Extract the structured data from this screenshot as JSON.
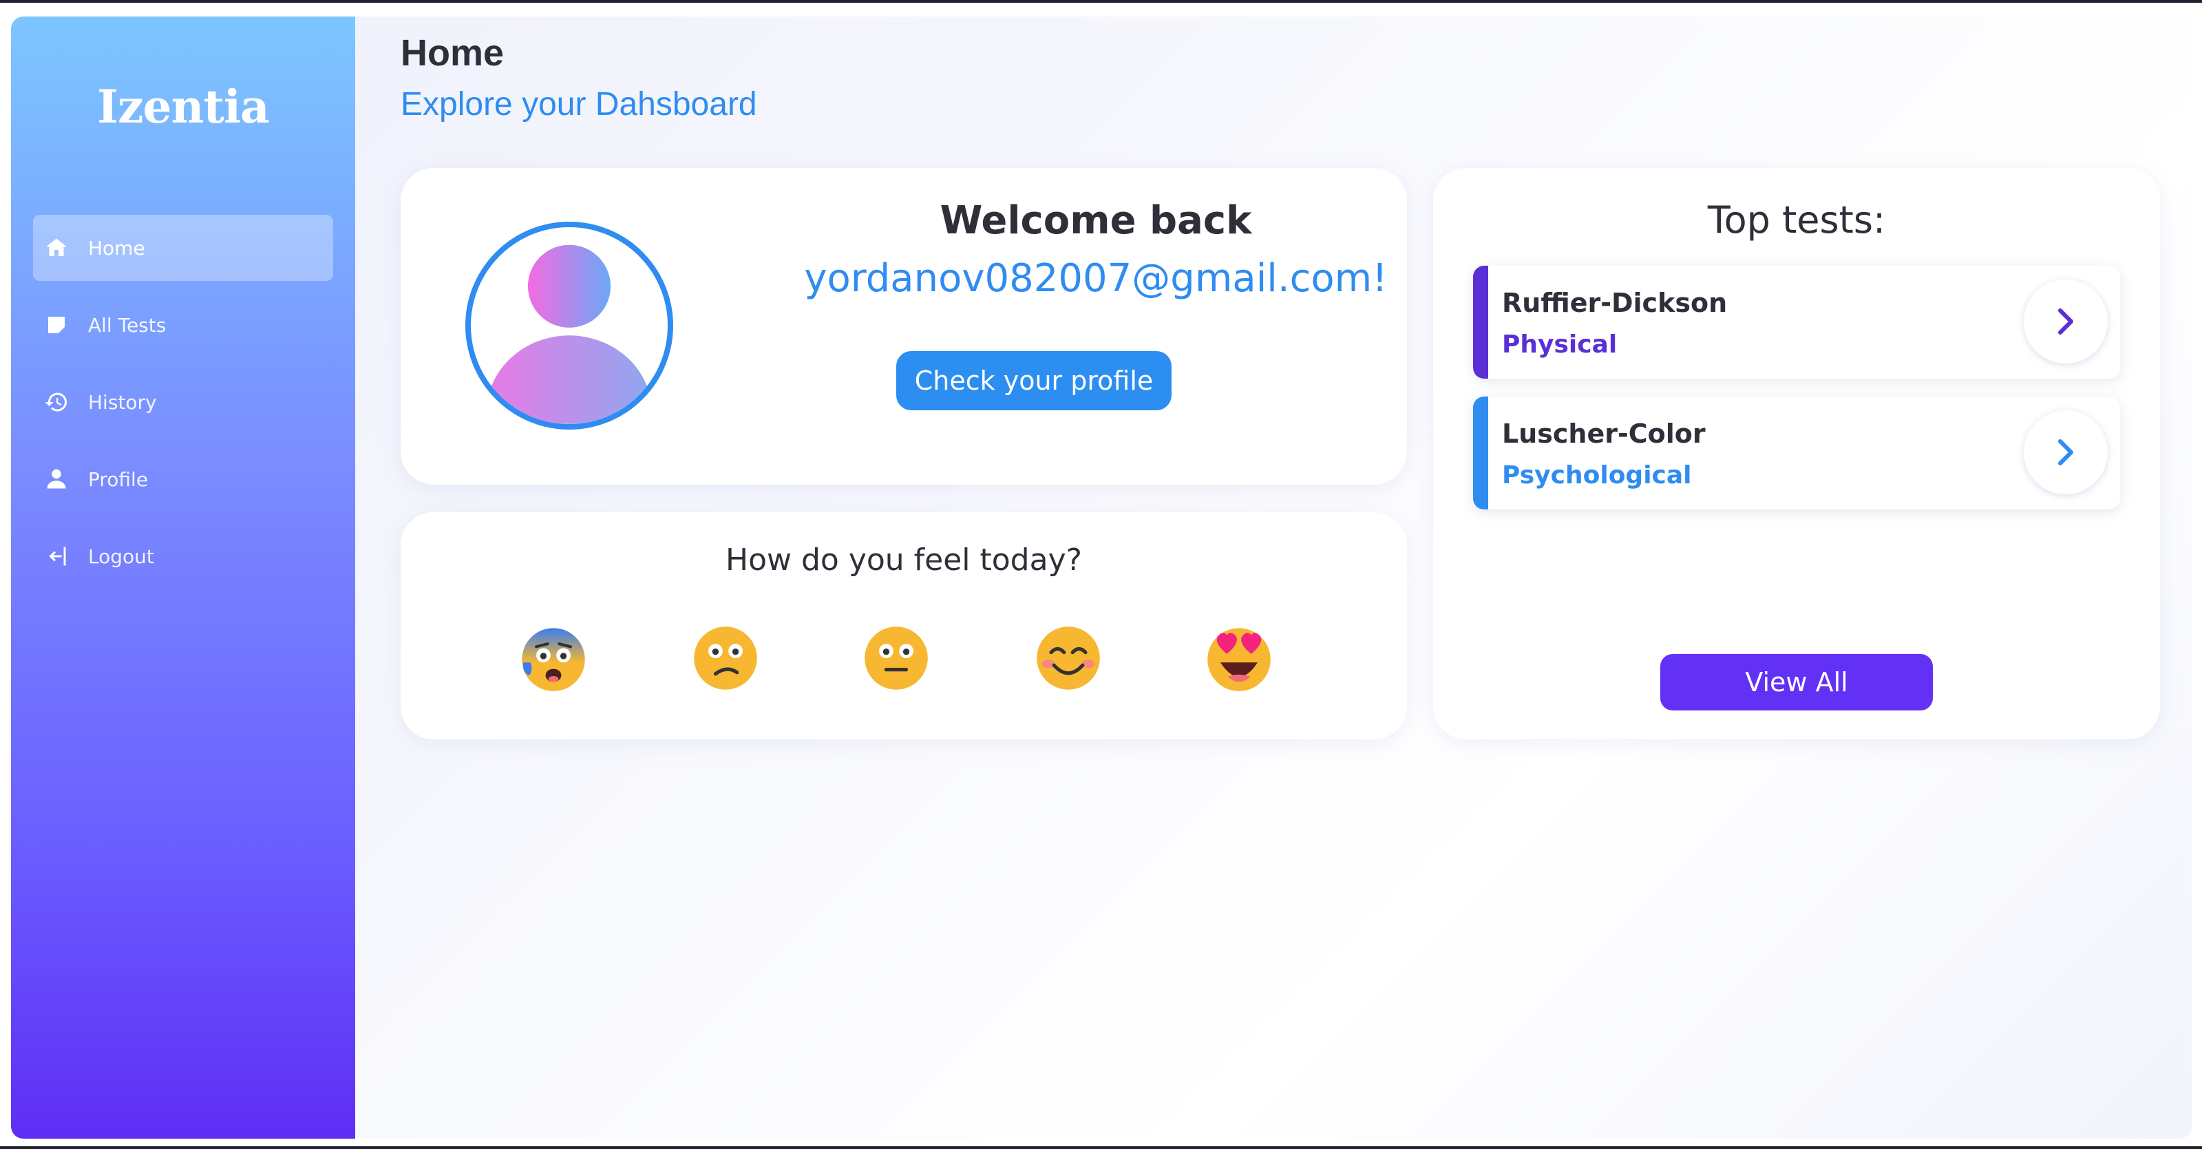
{
  "app": {
    "logo": "Izentia"
  },
  "sidebar": {
    "items": [
      {
        "label": "Home",
        "icon": "home-icon",
        "active": true
      },
      {
        "label": "All Tests",
        "icon": "note-icon",
        "active": false
      },
      {
        "label": "History",
        "icon": "history-icon",
        "active": false
      },
      {
        "label": "Profile",
        "icon": "person-icon",
        "active": false
      },
      {
        "label": "Logout",
        "icon": "logout-icon",
        "active": false
      }
    ]
  },
  "header": {
    "title": "Home",
    "subtitle": "Explore your Dahsboard"
  },
  "welcome": {
    "title": "Welcome back",
    "email": "yordanov082007@gmail.com!",
    "profile_button": "Check your profile",
    "avatar_icon": "user-avatar-icon"
  },
  "mood": {
    "question": "How do you feel today?",
    "emojis": [
      {
        "icon": "anxious-face-icon"
      },
      {
        "icon": "confused-face-icon"
      },
      {
        "icon": "neutral-face-icon"
      },
      {
        "icon": "smiling-face-icon"
      },
      {
        "icon": "heart-eyes-face-icon"
      }
    ]
  },
  "top_tests": {
    "title": "Top tests:",
    "items": [
      {
        "name": "Ruffier-Dickson",
        "category": "Physical",
        "color": "#5a2fd6"
      },
      {
        "name": "Luscher-Color",
        "category": "Psychological",
        "color": "#2f8cf0"
      }
    ],
    "view_all": "View All"
  },
  "colors": {
    "accent_blue": "#2f8cf0",
    "accent_purple": "#6330f5",
    "text_dark": "#2f2f3a"
  }
}
